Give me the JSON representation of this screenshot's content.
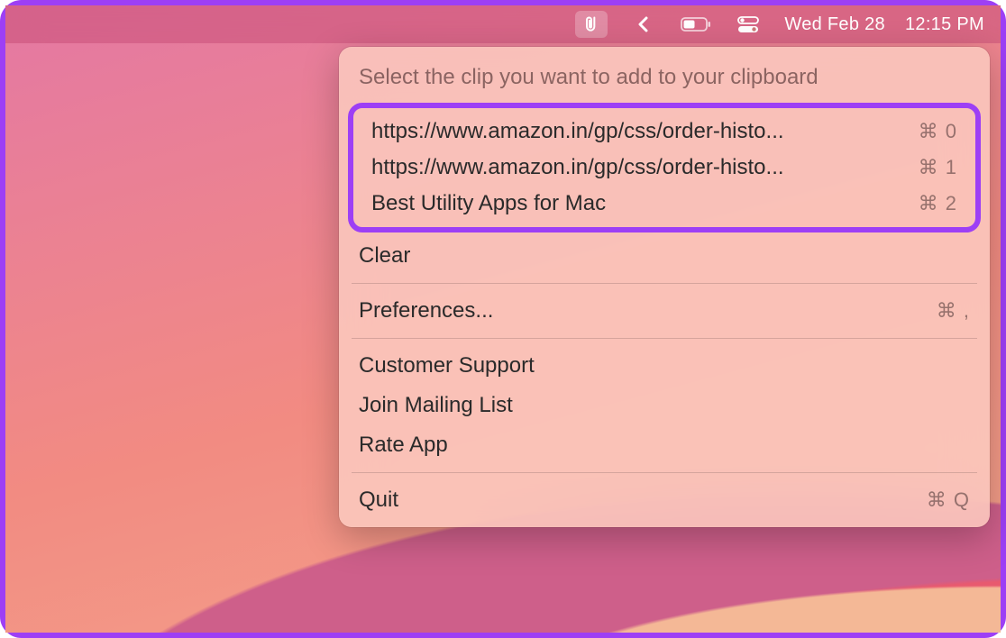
{
  "menubar": {
    "date": "Wed Feb 28",
    "time": "12:15 PM"
  },
  "menu": {
    "header": "Select the clip you want to add to your clipboard",
    "clips": [
      {
        "text": "https://www.amazon.in/gp/css/order-histo...",
        "shortcut": "⌘ 0"
      },
      {
        "text": "https://www.amazon.in/gp/css/order-histo...",
        "shortcut": "⌘ 1"
      },
      {
        "text": "Best Utility Apps for Mac",
        "shortcut": "⌘ 2"
      }
    ],
    "clear": "Clear",
    "preferences": {
      "label": "Preferences...",
      "shortcut": "⌘ ,"
    },
    "customerSupport": "Customer Support",
    "joinMailing": "Join Mailing List",
    "rateApp": "Rate App",
    "quit": {
      "label": "Quit",
      "shortcut": "⌘ Q"
    }
  }
}
